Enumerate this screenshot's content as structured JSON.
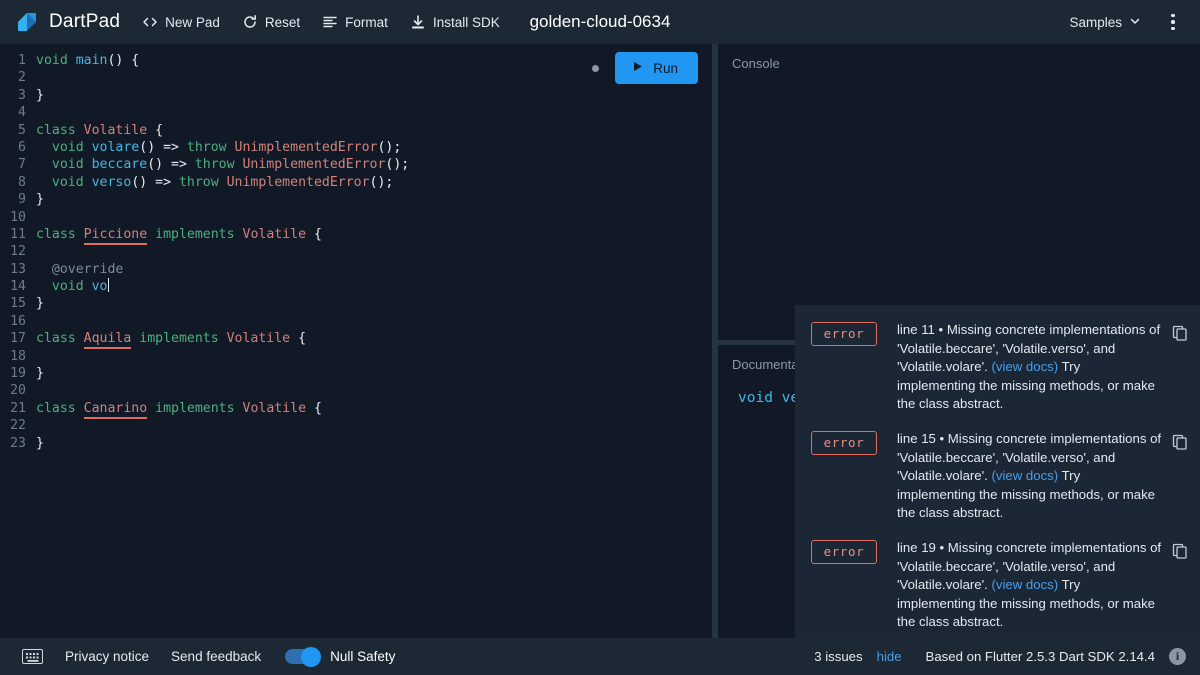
{
  "header": {
    "brand": "DartPad",
    "logo_icon": "dart-logo-icon",
    "actions": [
      {
        "label": "New Pad",
        "icon": "code-brackets-icon"
      },
      {
        "label": "Reset",
        "icon": "refresh-icon"
      },
      {
        "label": "Format",
        "icon": "format-lines-icon"
      },
      {
        "label": "Install SDK",
        "icon": "download-icon"
      }
    ],
    "doc_title": "golden-cloud-0634",
    "samples_label": "Samples",
    "samples_chevron": "chevron-down-icon",
    "overflow_menu": "kebab-menu-icon"
  },
  "editor": {
    "run_label": "Run",
    "run_icon": "play-icon",
    "unsaved_indicator": "unsaved-dot",
    "lines": [
      {
        "n": "1",
        "tokens": [
          {
            "t": "kw",
            "v": "void"
          },
          {
            "t": "pl",
            "v": " "
          },
          {
            "t": "fn",
            "v": "main"
          },
          {
            "t": "pl",
            "v": "() {"
          }
        ]
      },
      {
        "n": "2",
        "tokens": []
      },
      {
        "n": "3",
        "tokens": [
          {
            "t": "pl",
            "v": "}"
          }
        ]
      },
      {
        "n": "4",
        "tokens": []
      },
      {
        "n": "5",
        "tokens": [
          {
            "t": "kw",
            "v": "class"
          },
          {
            "t": "pl",
            "v": " "
          },
          {
            "t": "typ",
            "v": "Volatile"
          },
          {
            "t": "pl",
            "v": " {"
          }
        ]
      },
      {
        "n": "6",
        "tokens": [
          {
            "t": "pl",
            "v": "  "
          },
          {
            "t": "kw",
            "v": "void"
          },
          {
            "t": "pl",
            "v": " "
          },
          {
            "t": "fn",
            "v": "volare"
          },
          {
            "t": "pl",
            "v": "() => "
          },
          {
            "t": "kw",
            "v": "throw"
          },
          {
            "t": "pl",
            "v": " "
          },
          {
            "t": "typ",
            "v": "UnimplementedError"
          },
          {
            "t": "pl",
            "v": "();"
          }
        ]
      },
      {
        "n": "7",
        "tokens": [
          {
            "t": "pl",
            "v": "  "
          },
          {
            "t": "kw",
            "v": "void"
          },
          {
            "t": "pl",
            "v": " "
          },
          {
            "t": "fn",
            "v": "beccare"
          },
          {
            "t": "pl",
            "v": "() => "
          },
          {
            "t": "kw",
            "v": "throw"
          },
          {
            "t": "pl",
            "v": " "
          },
          {
            "t": "typ",
            "v": "UnimplementedError"
          },
          {
            "t": "pl",
            "v": "();"
          }
        ]
      },
      {
        "n": "8",
        "tokens": [
          {
            "t": "pl",
            "v": "  "
          },
          {
            "t": "kw",
            "v": "void"
          },
          {
            "t": "pl",
            "v": " "
          },
          {
            "t": "fn",
            "v": "verso"
          },
          {
            "t": "pl",
            "v": "() => "
          },
          {
            "t": "kw",
            "v": "throw"
          },
          {
            "t": "pl",
            "v": " "
          },
          {
            "t": "typ",
            "v": "UnimplementedError"
          },
          {
            "t": "pl",
            "v": "();"
          }
        ]
      },
      {
        "n": "9",
        "tokens": [
          {
            "t": "pl",
            "v": "}"
          }
        ]
      },
      {
        "n": "10",
        "tokens": []
      },
      {
        "n": "11",
        "tokens": [
          {
            "t": "kw",
            "v": "class"
          },
          {
            "t": "pl",
            "v": " "
          },
          {
            "t": "err",
            "v": "Piccione"
          },
          {
            "t": "pl",
            "v": " "
          },
          {
            "t": "kw",
            "v": "implements"
          },
          {
            "t": "pl",
            "v": " "
          },
          {
            "t": "typ",
            "v": "Volatile"
          },
          {
            "t": "pl",
            "v": " {"
          }
        ]
      },
      {
        "n": "12",
        "tokens": []
      },
      {
        "n": "13",
        "tokens": [
          {
            "t": "pl",
            "v": "  "
          },
          {
            "t": "cm",
            "v": "@override"
          }
        ]
      },
      {
        "n": "14",
        "tokens": [
          {
            "t": "pl",
            "v": "  "
          },
          {
            "t": "kw",
            "v": "void"
          },
          {
            "t": "pl",
            "v": " "
          },
          {
            "t": "fn",
            "v": "vo"
          },
          {
            "t": "caret",
            "v": ""
          }
        ]
      },
      {
        "n": "15",
        "tokens": [
          {
            "t": "pl",
            "v": "}"
          }
        ]
      },
      {
        "n": "16",
        "tokens": []
      },
      {
        "n": "17",
        "tokens": [
          {
            "t": "kw",
            "v": "class"
          },
          {
            "t": "pl",
            "v": " "
          },
          {
            "t": "err",
            "v": "Aquila"
          },
          {
            "t": "pl",
            "v": " "
          },
          {
            "t": "kw",
            "v": "implements"
          },
          {
            "t": "pl",
            "v": " "
          },
          {
            "t": "typ",
            "v": "Volatile"
          },
          {
            "t": "pl",
            "v": " {"
          }
        ]
      },
      {
        "n": "18",
        "tokens": []
      },
      {
        "n": "19",
        "tokens": [
          {
            "t": "pl",
            "v": "}"
          }
        ]
      },
      {
        "n": "20",
        "tokens": []
      },
      {
        "n": "21",
        "tokens": [
          {
            "t": "kw",
            "v": "class"
          },
          {
            "t": "pl",
            "v": " "
          },
          {
            "t": "err",
            "v": "Canarino"
          },
          {
            "t": "pl",
            "v": " "
          },
          {
            "t": "kw",
            "v": "implements"
          },
          {
            "t": "pl",
            "v": " "
          },
          {
            "t": "typ",
            "v": "Volatile"
          },
          {
            "t": "pl",
            "v": " {"
          }
        ]
      },
      {
        "n": "22",
        "tokens": []
      },
      {
        "n": "23",
        "tokens": [
          {
            "t": "pl",
            "v": "}"
          }
        ]
      }
    ]
  },
  "console": {
    "label": "Console",
    "content": ""
  },
  "documentation": {
    "label": "Documentation",
    "signature": "void ve"
  },
  "issues": {
    "items": [
      {
        "severity": "error",
        "message": "line 11 • Missing concrete implementations of 'Volatile.beccare', 'Volatile.verso', and 'Volatile.volare'.",
        "view_docs": "(view docs)",
        "correction": "Try implementing the missing methods, or make the class abstract.",
        "copy_icon": "copy-icon"
      },
      {
        "severity": "error",
        "message": "line 15 • Missing concrete implementations of 'Volatile.beccare', 'Volatile.verso', and 'Volatile.volare'.",
        "view_docs": "(view docs)",
        "correction": "Try implementing the missing methods, or make the class abstract.",
        "copy_icon": "copy-icon"
      },
      {
        "severity": "error",
        "message": "line 19 • Missing concrete implementations of 'Volatile.beccare', 'Volatile.verso', and 'Volatile.volare'.",
        "view_docs": "(view docs)",
        "correction": "Try implementing the missing methods, or make the class abstract.",
        "copy_icon": "copy-icon"
      }
    ]
  },
  "footer": {
    "keyboard_icon": "keyboard-icon",
    "privacy_label": "Privacy notice",
    "feedback_label": "Send feedback",
    "null_safety_label": "Null Safety",
    "null_safety_on": true,
    "issue_count": "3 issues",
    "hide_label": "hide",
    "sdk_version": "Based on Flutter 2.5.3 Dart SDK 2.14.4",
    "info_icon": "info-icon",
    "info_glyph": "i"
  },
  "colors": {
    "accent_blue": "#2196f3",
    "link_blue": "#4a9eea",
    "error_red": "#e06c5e",
    "header_bg": "#1c2834",
    "editor_bg": "#111926",
    "panel_bg": "#1b2735"
  }
}
